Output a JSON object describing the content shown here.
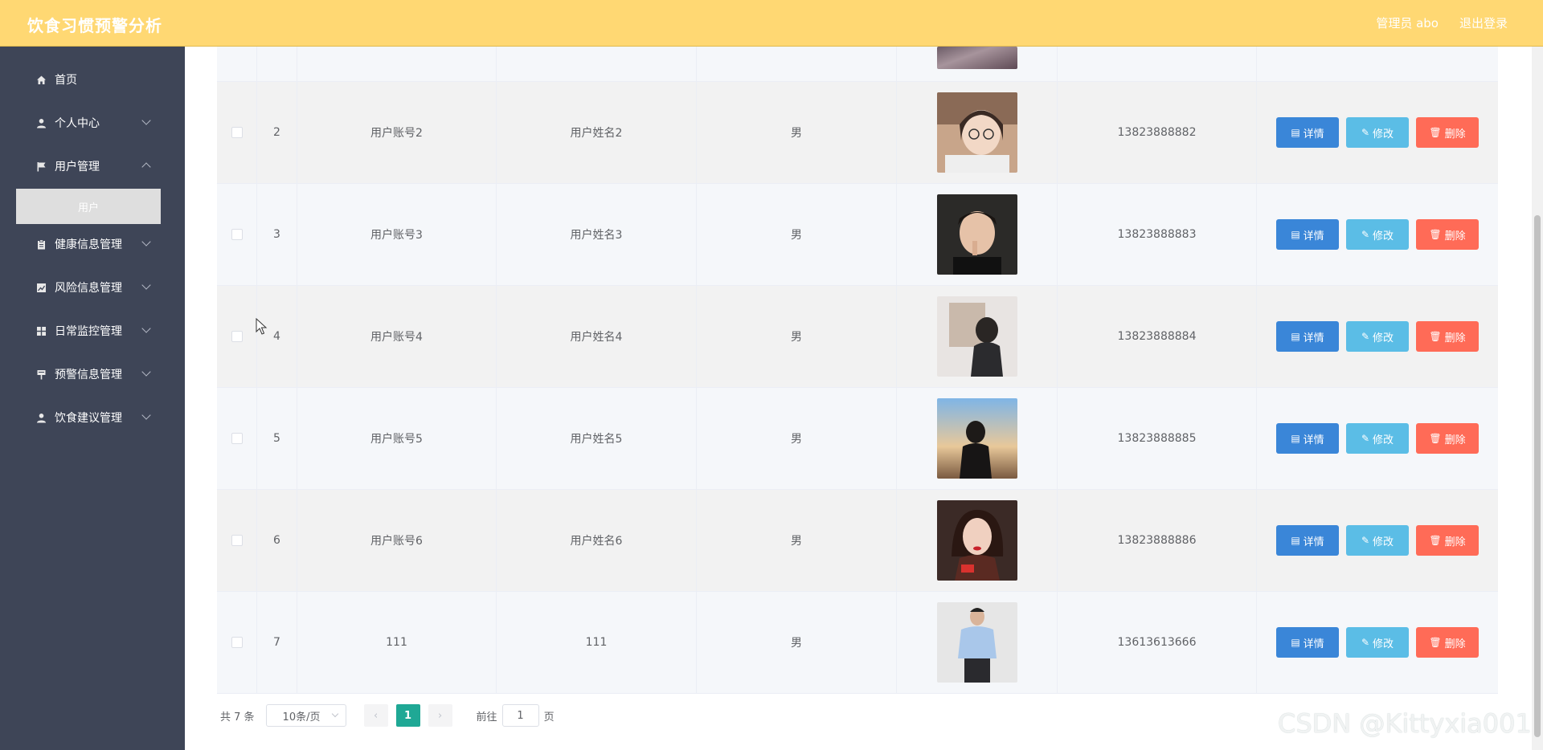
{
  "header": {
    "title": "饮食习惯预警分析",
    "admin_label": "管理员 abo",
    "logout_label": "退出登录"
  },
  "sidebar": {
    "items": [
      {
        "label": "首页",
        "icon": "home-icon",
        "has_children": false
      },
      {
        "label": "个人中心",
        "icon": "user-icon",
        "has_children": true
      },
      {
        "label": "用户管理",
        "icon": "flag-icon",
        "has_children": true
      },
      {
        "label": "健康信息管理",
        "icon": "clipboard-icon",
        "has_children": true
      },
      {
        "label": "风险信息管理",
        "icon": "chart-icon",
        "has_children": true
      },
      {
        "label": "日常监控管理",
        "icon": "grid-icon",
        "has_children": true
      },
      {
        "label": "预警信息管理",
        "icon": "sign-icon",
        "has_children": true
      },
      {
        "label": "饮食建议管理",
        "icon": "user-icon",
        "has_children": true
      }
    ],
    "active_submenu": "用户"
  },
  "table": {
    "buttons": {
      "detail": "详情",
      "edit": "修改",
      "delete": "删除"
    },
    "rows": [
      {
        "index": "2",
        "account": "用户账号2",
        "name": "用户姓名2",
        "gender": "男",
        "phone": "13823888882"
      },
      {
        "index": "3",
        "account": "用户账号3",
        "name": "用户姓名3",
        "gender": "男",
        "phone": "13823888883"
      },
      {
        "index": "4",
        "account": "用户账号4",
        "name": "用户姓名4",
        "gender": "男",
        "phone": "13823888884"
      },
      {
        "index": "5",
        "account": "用户账号5",
        "name": "用户姓名5",
        "gender": "男",
        "phone": "13823888885"
      },
      {
        "index": "6",
        "account": "用户账号6",
        "name": "用户姓名6",
        "gender": "男",
        "phone": "13823888886"
      },
      {
        "index": "7",
        "account": "111",
        "name": "111",
        "gender": "男",
        "phone": "13613613666"
      }
    ]
  },
  "pagination": {
    "total_label": "共 7 条",
    "page_size": "10条/页",
    "current_page": "1",
    "goto_label": "前往",
    "goto_value": "1",
    "page_suffix": "页"
  },
  "watermark": "CSDN @Kittyxia001",
  "colors": {
    "header": "#ffd873",
    "sidebar": "#3e4557",
    "detail": "#3a86d8",
    "edit": "#5bbde6",
    "delete": "#ff6b57",
    "page_active": "#1fa895"
  }
}
